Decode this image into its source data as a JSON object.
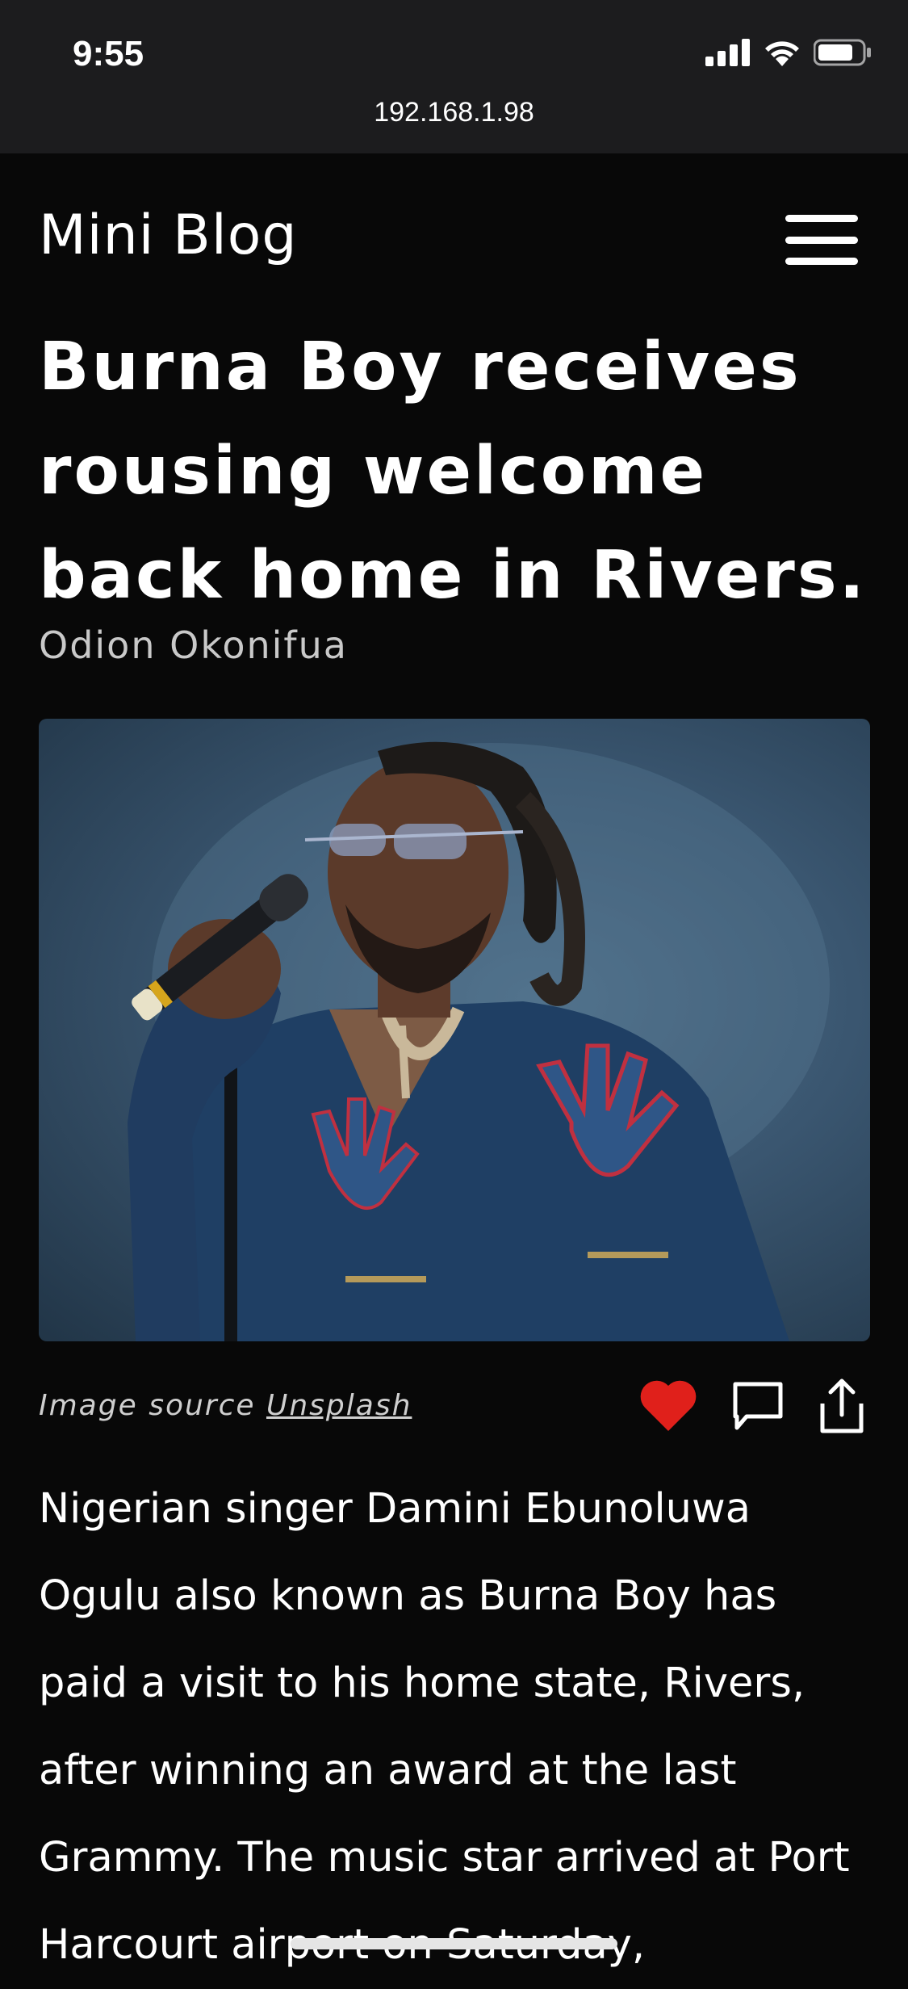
{
  "status_bar": {
    "time": "9:55"
  },
  "browser": {
    "url": "192.168.1.98"
  },
  "site": {
    "title": "Mini Blog"
  },
  "article": {
    "headline": "Burna Boy receives rousing welcome back home in Rivers.",
    "author": "Odion Okonifua",
    "image_caption_prefix": "Image source ",
    "image_source_link": "Unsplash",
    "body": "Nigerian singer Damini Ebunoluwa Ogulu also known as Burna Boy has paid a visit to his home state, Rivers, after winning an award at the last Grammy. The music star arrived at Port Harcourt airport on Saturday,"
  },
  "actions": {
    "like_color": "#e0201b"
  },
  "colors": {
    "background": "#080808",
    "topbar": "#1c1c1e",
    "text": "#ffffff",
    "muted": "#c9c9c9"
  }
}
